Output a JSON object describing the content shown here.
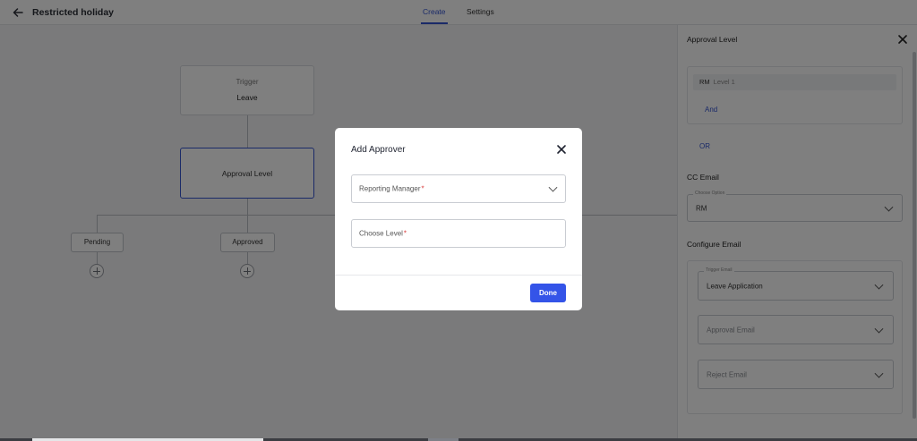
{
  "header": {
    "title": "Restricted holiday",
    "tabs": [
      {
        "label": "Create",
        "active": true
      },
      {
        "label": "Settings",
        "active": false
      }
    ]
  },
  "workflow": {
    "trigger_label": "Trigger",
    "trigger_value": "Leave",
    "approval_node": "Approval Level",
    "outcomes": [
      "Pending",
      "Approved"
    ]
  },
  "panel": {
    "title": "Approval Level",
    "level_role": "RM",
    "level_name": "Level 1",
    "and_link": "And",
    "or_link": "OR",
    "cc_heading": "CC Email",
    "cc_legend": "Choose Option",
    "cc_value": "RM",
    "configure_heading": "Configure Email",
    "trigger_legend": "Trigger Email",
    "trigger_value": "Leave Application",
    "approval_placeholder": "Approval Email",
    "reject_placeholder": "Reject Email"
  },
  "modal": {
    "title": "Add Approver",
    "manager_label": "Reporting Manager",
    "level_label": "Choose Level",
    "required_mark": "*",
    "done_label": "Done"
  },
  "colors": {
    "accent": "#3454e8",
    "required": "#d93636"
  },
  "icons": {
    "back": "arrow-left-icon",
    "close": "close-icon",
    "dropdown": "chevron-down-icon",
    "add": "plus-circle-icon"
  }
}
